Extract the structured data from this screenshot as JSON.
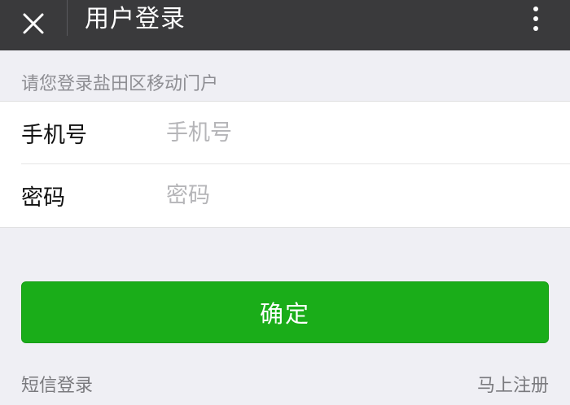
{
  "header": {
    "title": "用户登录",
    "close_icon": "close-icon",
    "more_icon": "more-vertical-icon"
  },
  "prompt": "请您登录盐田区移动门户",
  "form": {
    "phone": {
      "label": "手机号",
      "placeholder": "手机号",
      "value": ""
    },
    "password": {
      "label": "密码",
      "placeholder": "密码",
      "value": ""
    }
  },
  "actions": {
    "confirm_label": "确定",
    "sms_login_label": "短信登录",
    "register_label": "马上注册"
  },
  "colors": {
    "topbar": "#3a3a3c",
    "background": "#efeff4",
    "primary_button": "#1aad19",
    "muted_text": "#8e8e93"
  }
}
